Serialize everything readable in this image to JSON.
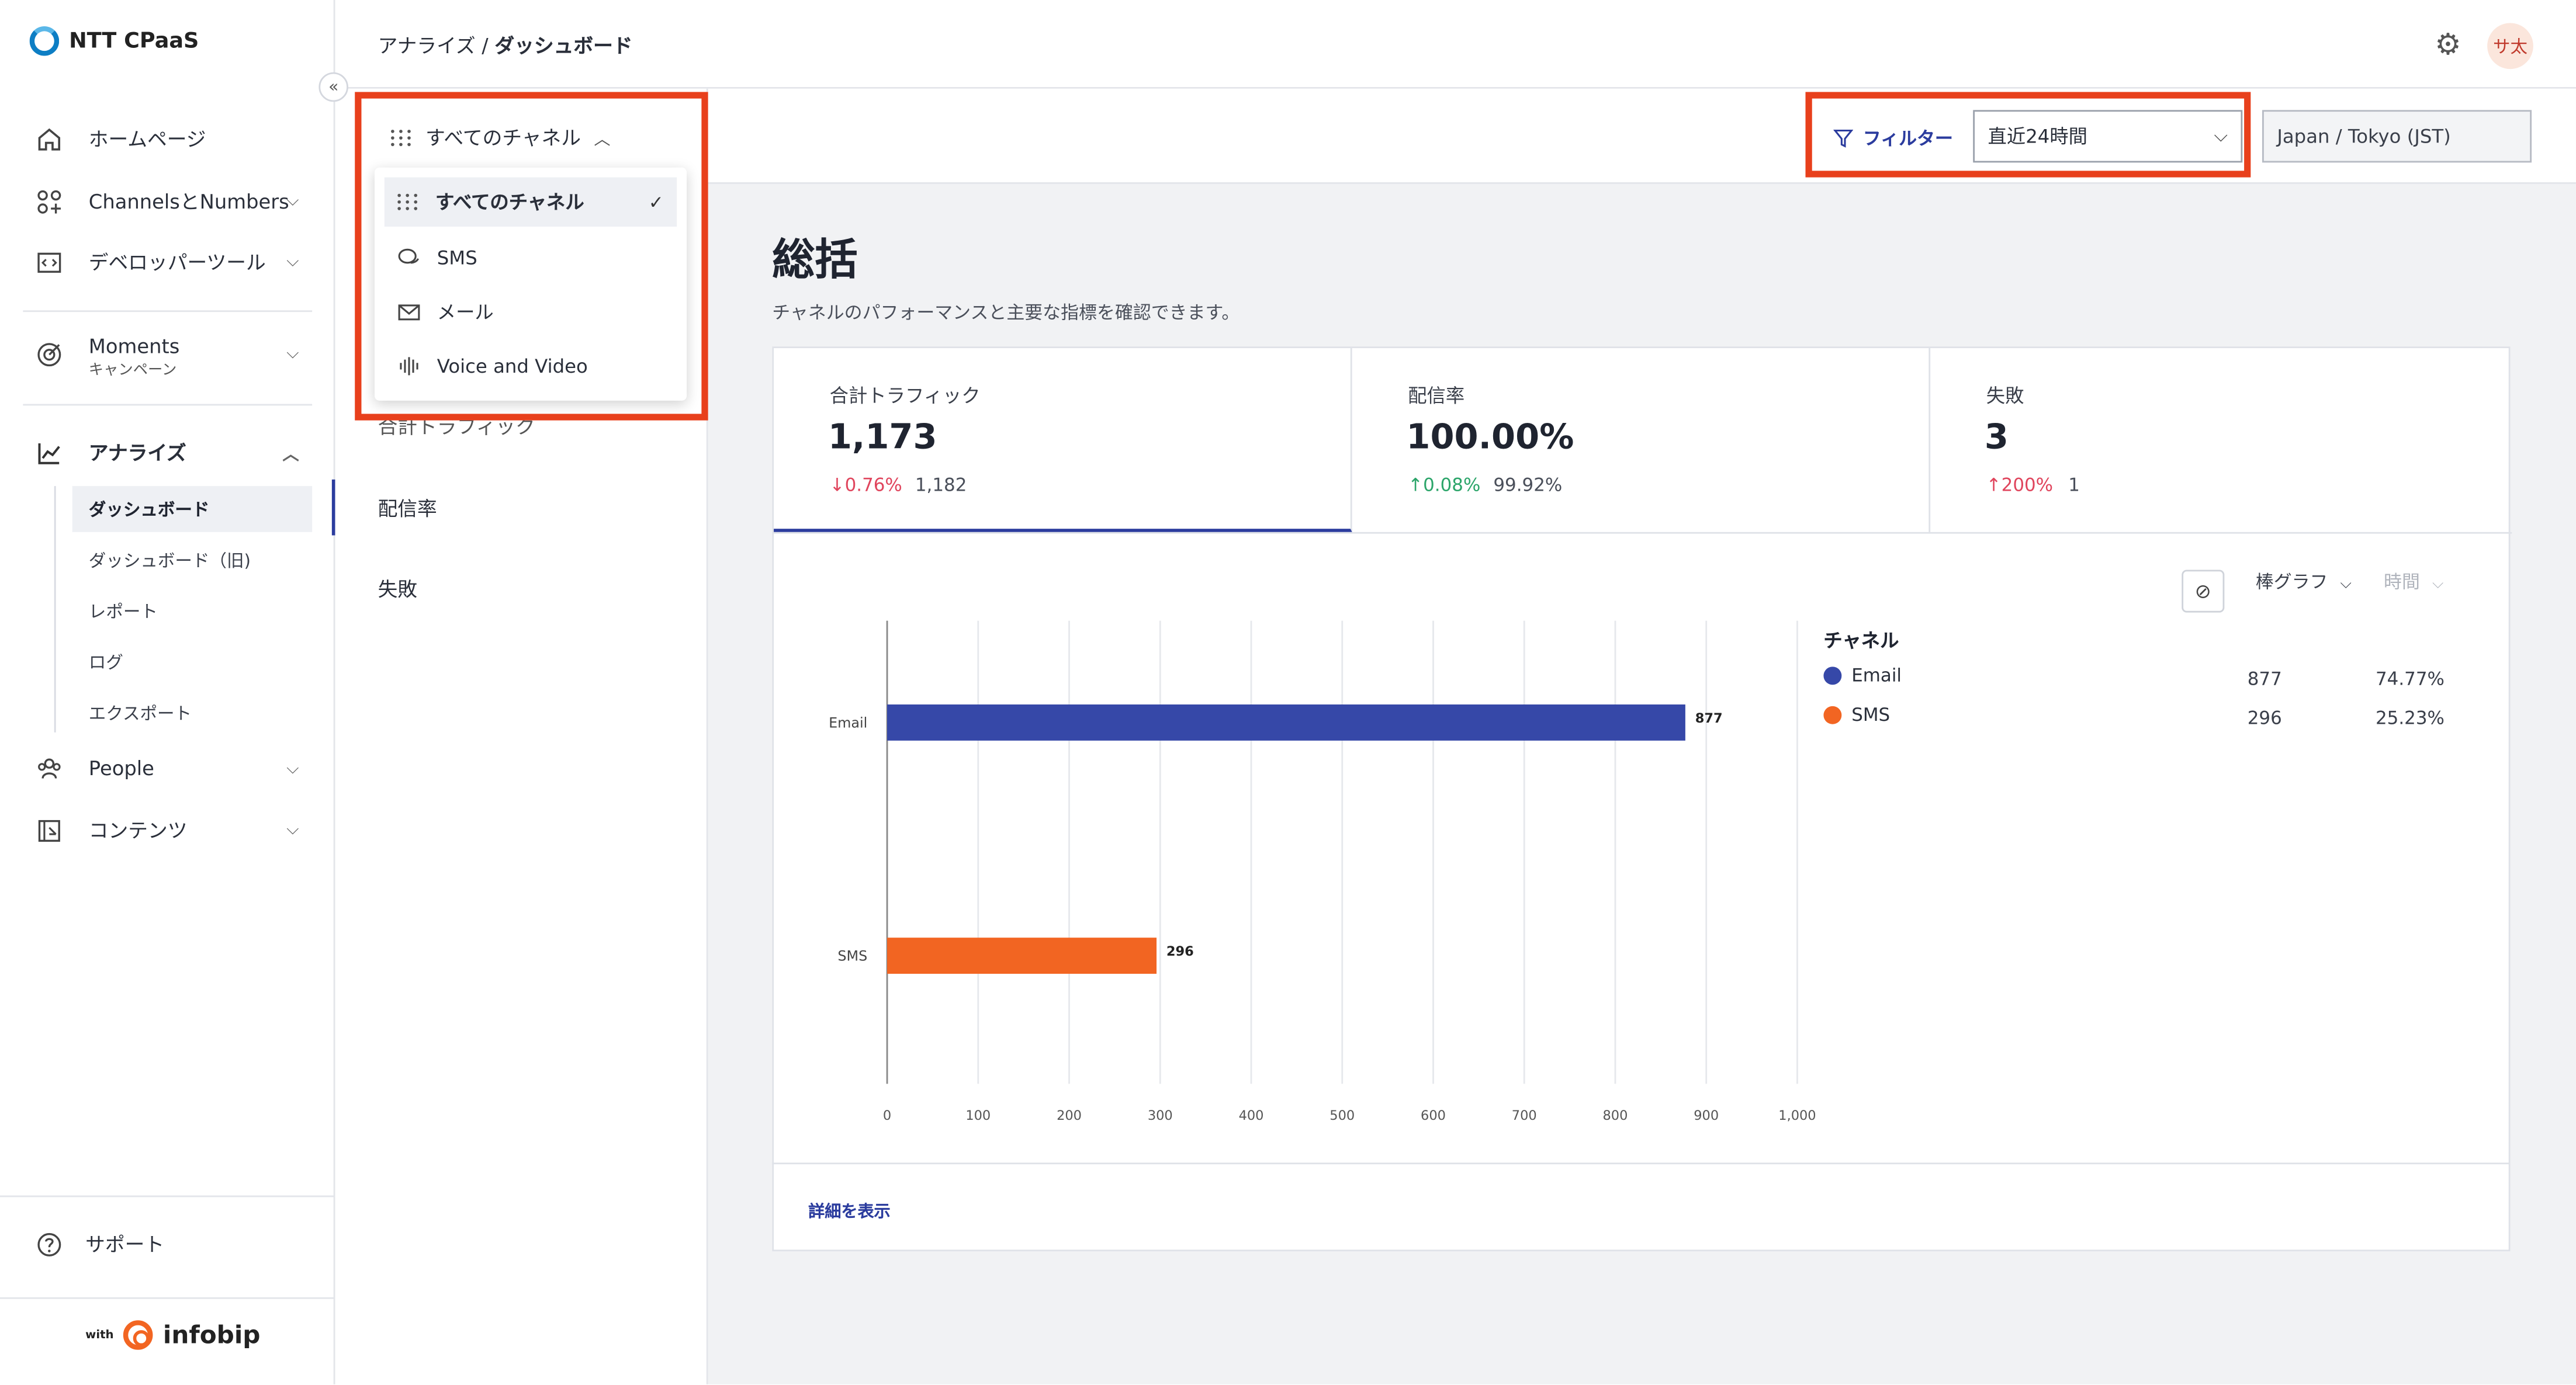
{
  "brand": {
    "name": "NTT CPaaS",
    "powered_prefix": "with",
    "powered_name": "infobip",
    "accent": "#2b3c9e"
  },
  "sidebar": {
    "items": [
      {
        "label": "ホームページ",
        "icon": "home-icon"
      },
      {
        "label": "ChannelsとNumbers",
        "icon": "channels-icon"
      },
      {
        "label": "デベロッパーツール",
        "icon": "code-icon"
      },
      {
        "label": "Moments",
        "sublabel": "キャンペーン",
        "icon": "target-icon"
      },
      {
        "label": "アナライズ",
        "icon": "chart-icon"
      },
      {
        "label": "People",
        "icon": "people-icon"
      },
      {
        "label": "コンテンツ",
        "icon": "content-icon"
      }
    ],
    "analyze_sub": [
      "ダッシュボード",
      "ダッシュボード（旧)",
      "レポート",
      "ログ",
      "エクスポート"
    ],
    "support": "サポート"
  },
  "topbar": {
    "breadcrumb_parent": "アナライズ / ",
    "breadcrumb_current": "ダッシュボード",
    "avatar": "サ太"
  },
  "left_panel": {
    "dropdown_label": "すべてのチャネル",
    "options": [
      "すべてのチャネル",
      "SMS",
      "メール",
      "Voice and Video"
    ],
    "hidden_item_partial": "合計トラフィック",
    "items": [
      "配信率",
      "失敗"
    ]
  },
  "filters": {
    "filter_label": "フィルター",
    "period": "直近24時間",
    "timezone": "Japan / Tokyo (JST)"
  },
  "page": {
    "title": "総括",
    "subtitle": "チャネルのパフォーマンスと主要な指標を確認できます。"
  },
  "metrics": [
    {
      "label": "合計トラフィック",
      "value": "1,173",
      "delta": "↓0.76%",
      "prev": "1,182",
      "trend": "down-red"
    },
    {
      "label": "配信率",
      "value": "100.00%",
      "delta": "↑0.08%",
      "prev": "99.92%",
      "trend": "up-green"
    },
    {
      "label": "失敗",
      "value": "3",
      "delta": "↑200%",
      "prev": "1",
      "trend": "up-red"
    }
  ],
  "chart_controls": {
    "chart_type": "棒グラフ",
    "interval": "時間"
  },
  "legend": {
    "title": "チャネル",
    "rows": [
      {
        "name": "Email",
        "value": "877",
        "percent": "74.77%"
      },
      {
        "name": "SMS",
        "value": "296",
        "percent": "25.23%"
      }
    ]
  },
  "detail_link": "詳細を表示",
  "chart_data": {
    "type": "bar",
    "orientation": "horizontal",
    "categories": [
      "Email",
      "SMS"
    ],
    "values": [
      877,
      296
    ],
    "colors": [
      "#3648a8",
      "#f26522"
    ],
    "xlim": [
      0,
      1000
    ],
    "xticks": [
      "0",
      "100",
      "200",
      "300",
      "400",
      "500",
      "600",
      "700",
      "800",
      "900",
      "1,000"
    ],
    "grid": true
  }
}
